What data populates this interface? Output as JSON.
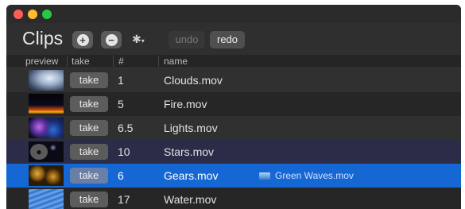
{
  "window": {
    "title": "Clips",
    "add_icon": "plus-circle-icon",
    "remove_icon": "minus-circle-icon",
    "settings_icon": "gear-icon"
  },
  "toolbar": {
    "undo_label": "undo",
    "redo_label": "redo"
  },
  "columns": [
    "preview",
    "take",
    "#",
    "name"
  ],
  "rows": [
    {
      "take_label": "take",
      "number": "1",
      "name": "Clouds.mov"
    },
    {
      "take_label": "take",
      "number": "5",
      "name": "Fire.mov"
    },
    {
      "take_label": "take",
      "number": "6.5",
      "name": "Lights.mov"
    },
    {
      "take_label": "take",
      "number": "10",
      "name": "Stars.mov"
    },
    {
      "take_label": "take",
      "number": "6",
      "name": "Gears.mov"
    },
    {
      "take_label": "take",
      "number": "17",
      "name": "Water.mov"
    }
  ],
  "drag_item": {
    "name": "Green Waves.mov",
    "icon": "video-file-icon"
  },
  "colors": {
    "accent": "#1567d3",
    "hover": "#2b2c48",
    "window_bg": "#2a2a2a"
  }
}
